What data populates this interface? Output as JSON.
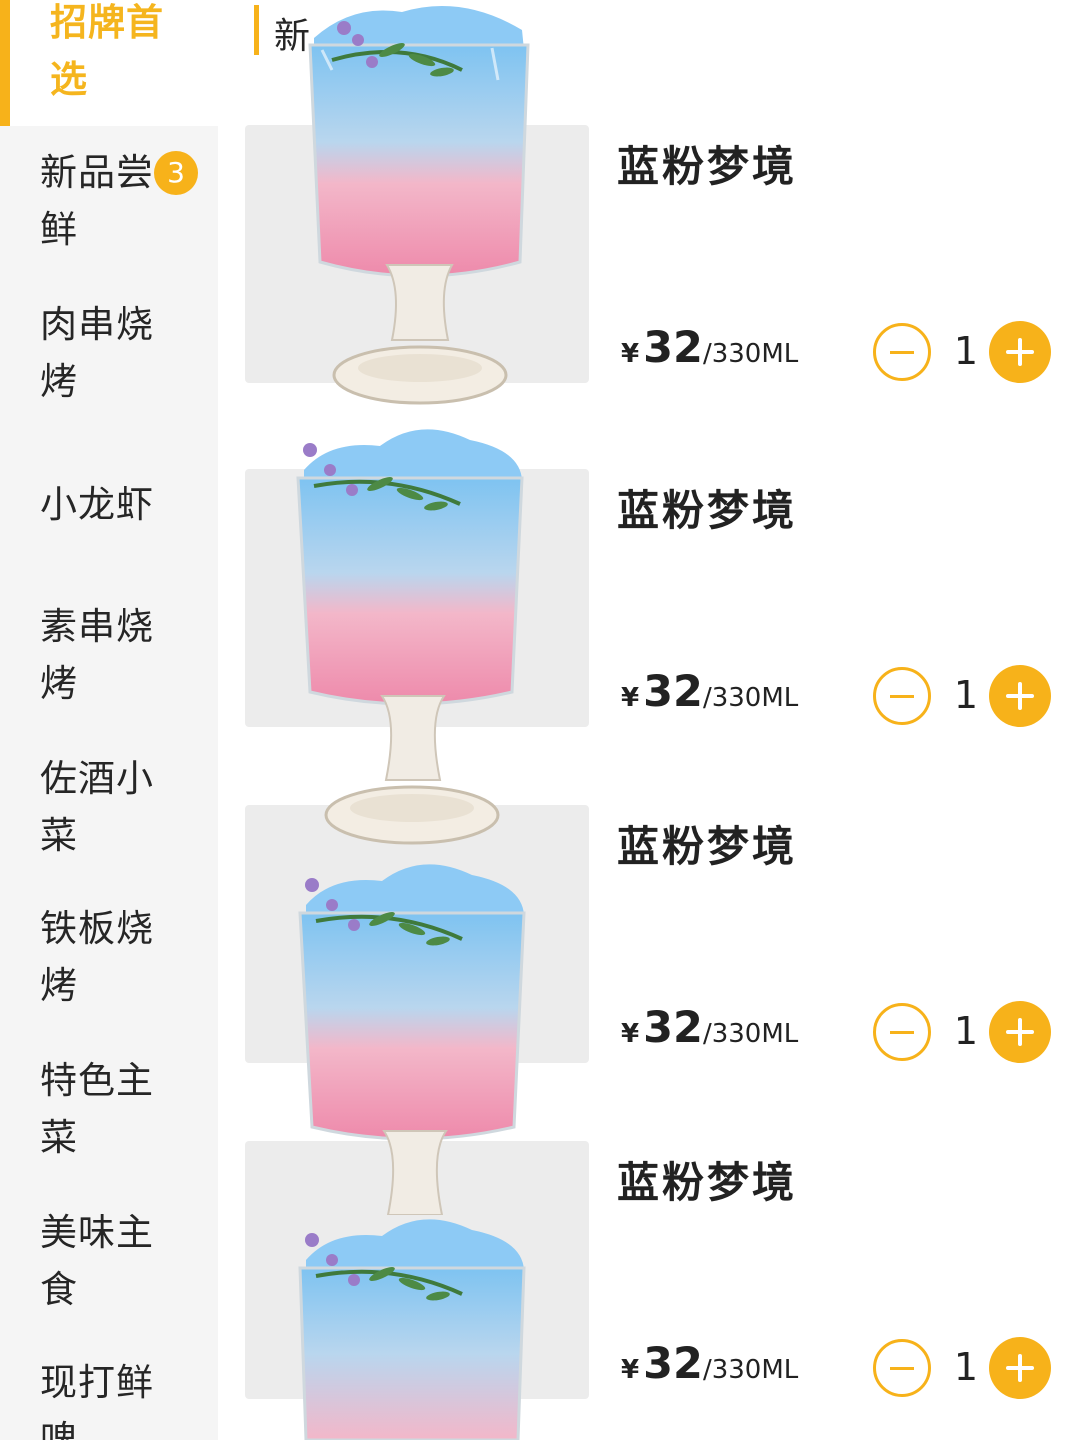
{
  "sidebar": {
    "items": [
      {
        "label": "招牌首选",
        "active": true
      },
      {
        "label": "新品尝鲜",
        "badge": "3"
      },
      {
        "label": "肉串烧烤"
      },
      {
        "label": "小龙虾"
      },
      {
        "label": "素串烧烤"
      },
      {
        "label": "佐酒小菜"
      },
      {
        "label": "铁板烧烤"
      },
      {
        "label": "特色主菜"
      },
      {
        "label": "美味主食"
      },
      {
        "label": "现打鲜啤"
      }
    ]
  },
  "section": {
    "title": "新"
  },
  "products": [
    {
      "name": "蓝粉梦境",
      "currency": "¥",
      "price": "32",
      "unit": "/330ML",
      "qty": "1"
    },
    {
      "name": "蓝粉梦境",
      "currency": "¥",
      "price": "32",
      "unit": "/330ML",
      "qty": "1"
    },
    {
      "name": "蓝粉梦境",
      "currency": "¥",
      "price": "32",
      "unit": "/330ML",
      "qty": "1"
    },
    {
      "name": "蓝粉梦境",
      "currency": "¥",
      "price": "32",
      "unit": "/330ML",
      "qty": "1"
    }
  ],
  "colors": {
    "accent": "#f7b21a",
    "sidebar_bg": "#f5f5f5",
    "drink_blue": "#8cc8f2",
    "drink_pink": "#f19bb5"
  },
  "icons": {
    "decrease": "minus-circle-icon",
    "increase": "plus-circle-icon"
  }
}
